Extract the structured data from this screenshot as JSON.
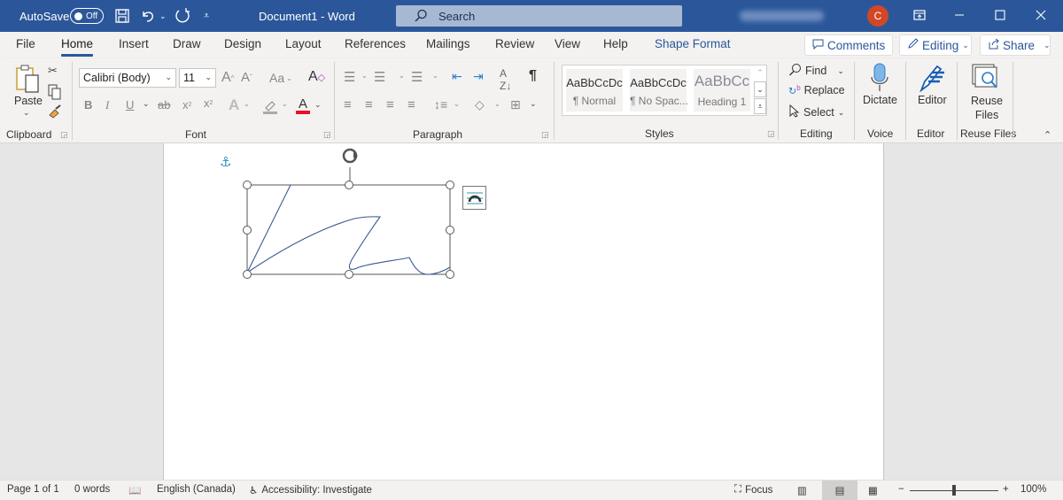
{
  "titlebar": {
    "autosave_label": "AutoSave",
    "autosave_state": "Off",
    "document_title": "Document1  -  Word",
    "search_placeholder": "Search",
    "user_initial": "C",
    "icons": [
      "save-icon",
      "undo-icon",
      "redo-icon",
      "customize-qat-icon",
      "ribbon-display-icon",
      "minimize-icon",
      "maximize-icon",
      "close-icon"
    ]
  },
  "tabs": [
    {
      "label": "File"
    },
    {
      "label": "Home",
      "active": true
    },
    {
      "label": "Insert"
    },
    {
      "label": "Draw"
    },
    {
      "label": "Design"
    },
    {
      "label": "Layout"
    },
    {
      "label": "References"
    },
    {
      "label": "Mailings"
    },
    {
      "label": "Review"
    },
    {
      "label": "View"
    },
    {
      "label": "Help"
    },
    {
      "label": "Shape Format"
    }
  ],
  "top_buttons": {
    "comments": "Comments",
    "editing": "Editing",
    "share": "Share"
  },
  "ribbon": {
    "clipboard": {
      "label": "Clipboard",
      "paste": "Paste"
    },
    "font": {
      "label": "Font",
      "font_name": "Calibri (Body)",
      "font_size": "11",
      "font_color": "#e81123"
    },
    "paragraph": {
      "label": "Paragraph"
    },
    "styles": {
      "label": "Styles",
      "items": [
        {
          "preview": "AaBbCcDc",
          "name": "¶ Normal"
        },
        {
          "preview": "AaBbCcDc",
          "name": "¶ No Spac..."
        },
        {
          "preview": "AaBbCc",
          "name": "Heading 1"
        }
      ]
    },
    "editing": {
      "label": "Editing",
      "find": "Find",
      "replace": "Replace",
      "select": "Select"
    },
    "voice": {
      "label": "Voice",
      "dictate": "Dictate"
    },
    "editor": {
      "label": "Editor",
      "editor": "Editor"
    },
    "reuse": {
      "label": "Reuse Files",
      "button_line1": "Reuse",
      "button_line2": "Files"
    }
  },
  "status": {
    "page": "Page 1 of 1",
    "words": "0 words",
    "language": "English (Canada)",
    "accessibility": "Accessibility: Investigate",
    "focus": "Focus",
    "zoom": "100%"
  }
}
